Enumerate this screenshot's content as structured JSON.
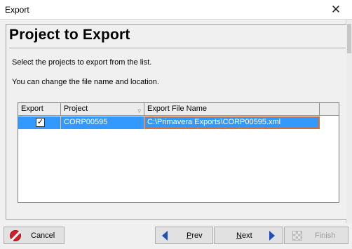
{
  "window": {
    "title": "Export",
    "close_glyph": "✕"
  },
  "page": {
    "heading": "Project to Export",
    "instruction_1": "Select the projects to export from the list.",
    "instruction_2": "You can change the file name and location."
  },
  "grid": {
    "columns": [
      "Export",
      "Project",
      "Export File Name"
    ],
    "rows": [
      {
        "export_checked": true,
        "check_glyph": "✓",
        "project": "CORP00595",
        "file_name": "C:\\Primavera Exports\\CORP00595.xml"
      }
    ]
  },
  "buttons": {
    "cancel": "Cancel",
    "prev_mnemonic": "P",
    "prev_rest": "rev",
    "next_mnemonic": "N",
    "next_rest": "ext",
    "finish": "Finish"
  },
  "icons": {
    "close": "close-icon",
    "sort": "sort-indicator-icon",
    "cancel": "cancel-icon",
    "prev": "arrow-left-icon",
    "next": "arrow-right-icon",
    "finish": "finish-flag-icon"
  },
  "colors": {
    "selection": "#3399ff",
    "focus_outline": "#d0703a",
    "cancel_red": "#d0202a",
    "arrow_blue": "#1f4fb4"
  }
}
